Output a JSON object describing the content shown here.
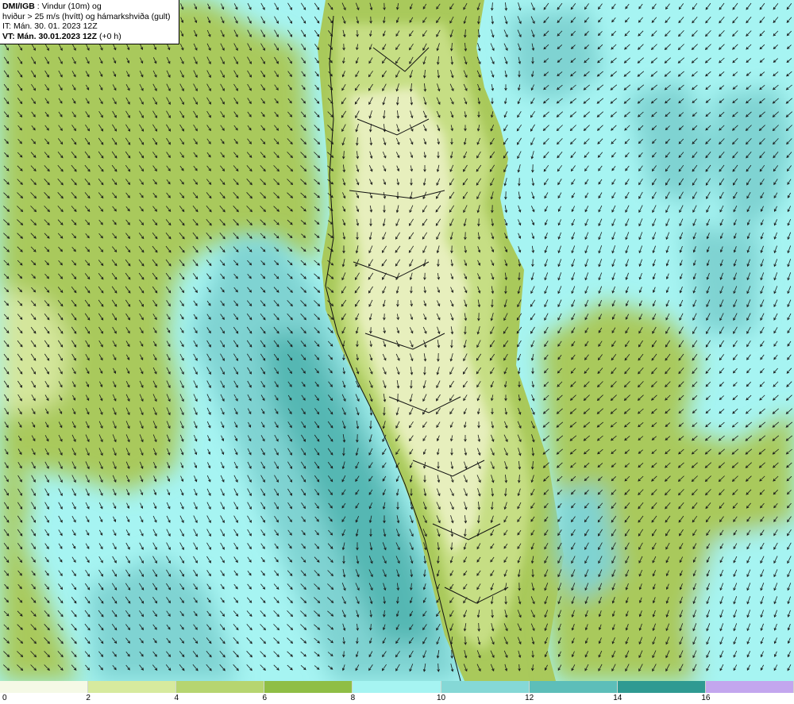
{
  "header": {
    "line1_source": "DMI/IGB",
    "line1_rest": " : Vindur (10m) og",
    "line2": "hviður > 25 m/s (hvítt) og hámarkshviða (gult)",
    "line3": "IT: Mán. 30. 01. 2023 12Z",
    "line4_bold": "VT: Mán. 30.01.2023 12Z",
    "line4_rest": " (+0 h)"
  },
  "colors": {
    "ocean_light": "#a6f4f2",
    "ocean_mid": "#7fd3d2",
    "ocean_deep": "#55b7b3",
    "land_green": "#a9c95b",
    "land_light": "#d4e69b",
    "land_pale": "#f3f7d9",
    "arrow": "#1a1a1a",
    "coast": "#111111"
  },
  "legend": {
    "colors": [
      "#f5f9e6",
      "#d7ea9e",
      "#b6d570",
      "#8fbe45",
      "#a6f4f2",
      "#85d8d6",
      "#5dbeb9",
      "#2f9a92",
      "#c3a6ee"
    ],
    "labels": [
      "0",
      "2",
      "4",
      "6",
      "8",
      "10",
      "12",
      "14",
      "16"
    ]
  }
}
